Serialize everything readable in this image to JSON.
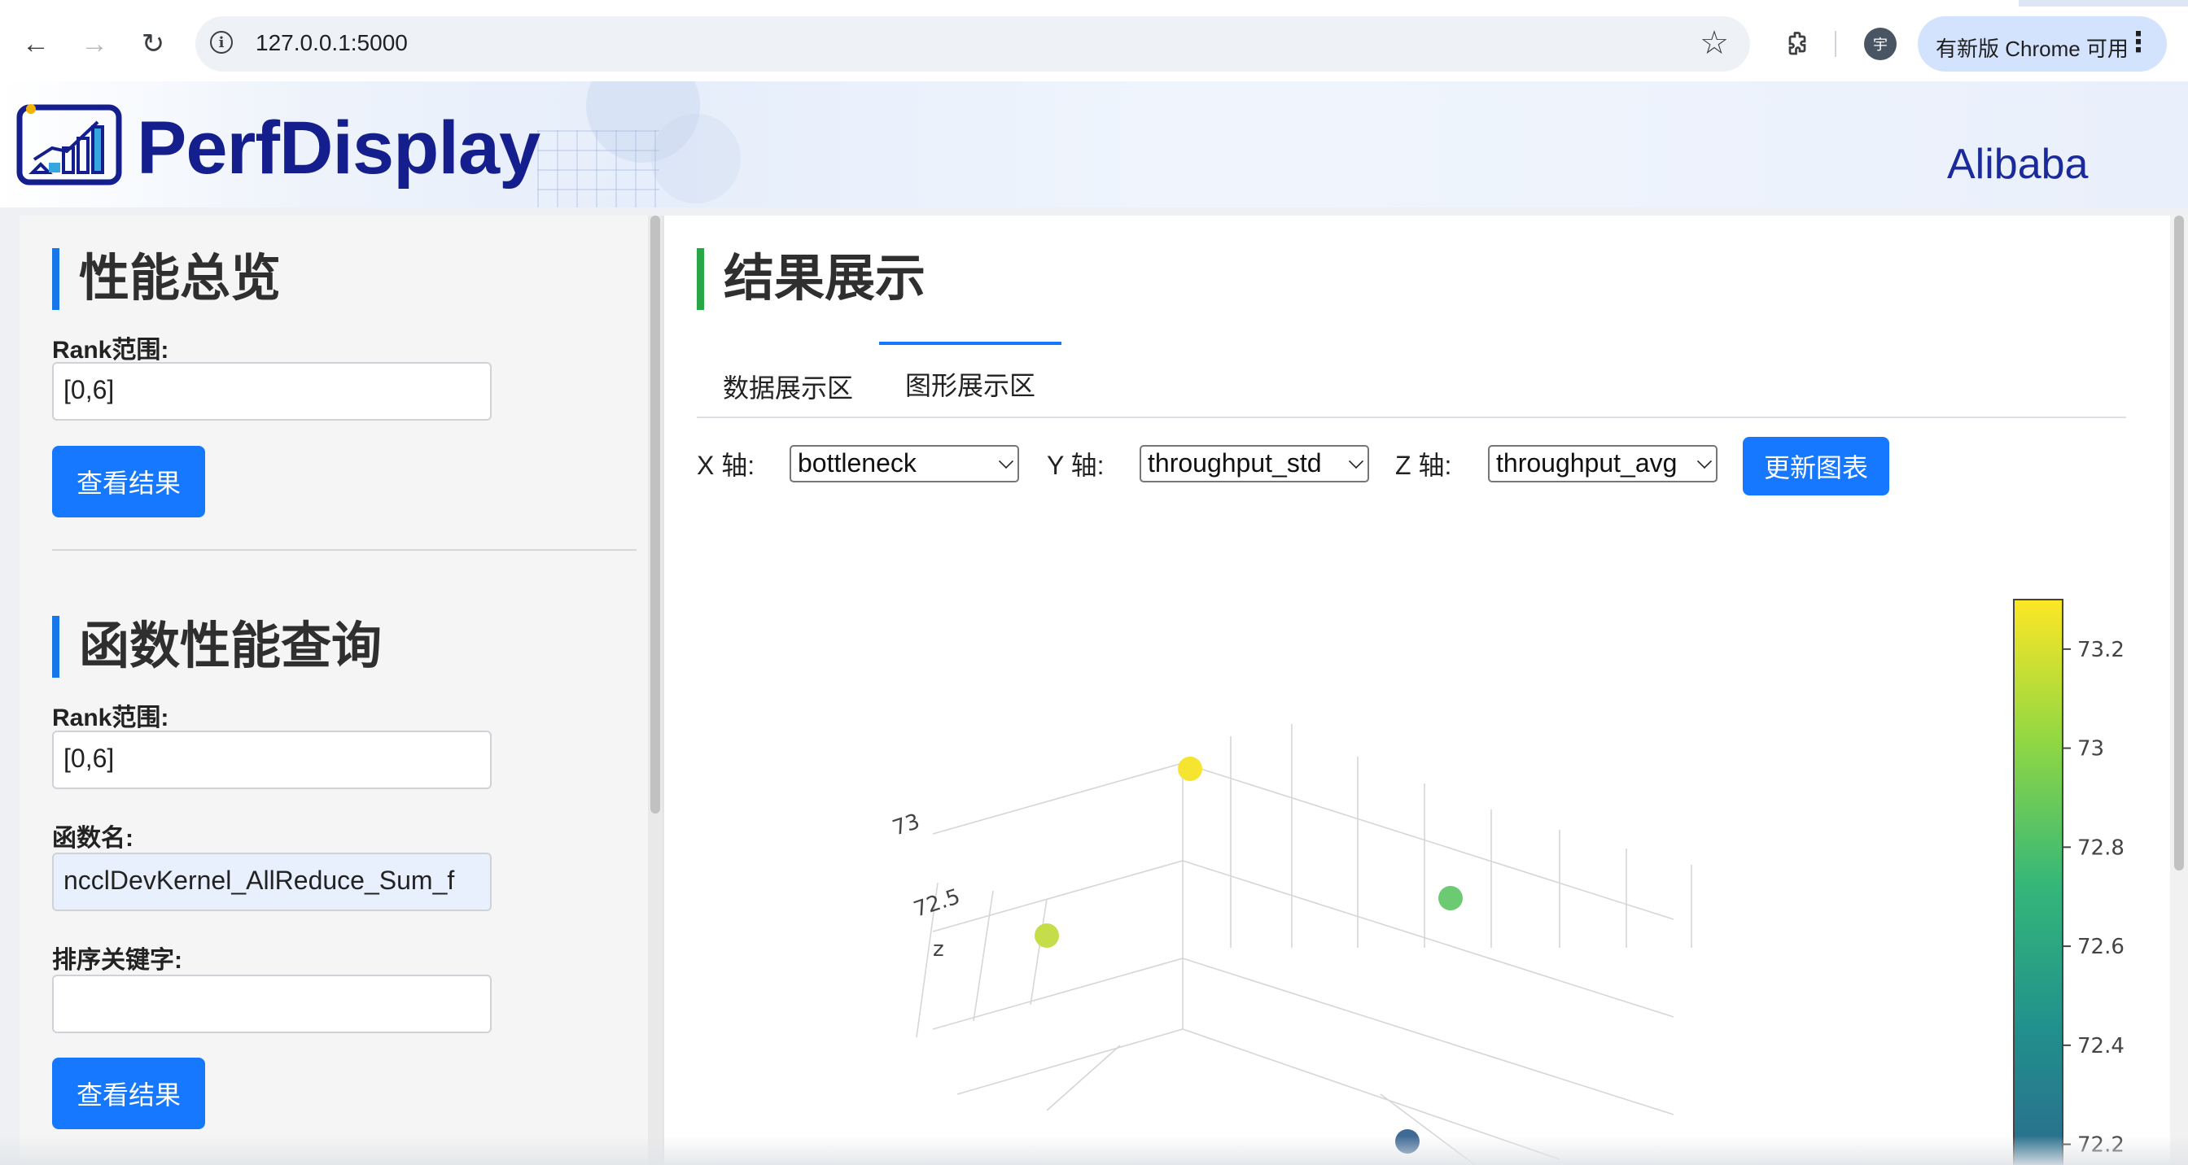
{
  "browser": {
    "url": "127.0.0.1:5000",
    "profile_initial": "宇",
    "update_label": "有新版 Chrome 可用"
  },
  "header": {
    "brand": "PerfDisplay",
    "company": "Alibaba"
  },
  "overview": {
    "title": "性能总览",
    "rank_label": "Rank范围:",
    "rank_value": "[0,6]",
    "submit_label": "查看结果"
  },
  "function_query": {
    "title": "函数性能查询",
    "rank_label": "Rank范围:",
    "rank_value": "[0,6]",
    "func_label": "函数名:",
    "func_value": "ncclDevKernel_AllReduce_Sum_f",
    "sort_label": "排序关键字:",
    "sort_value": "",
    "submit_label": "查看结果"
  },
  "results": {
    "title": "结果展示",
    "tabs": [
      {
        "label": "数据展示区",
        "active": false
      },
      {
        "label": "图形展示区",
        "active": true
      }
    ],
    "x_axis_label": "X 轴:",
    "x_axis_value": "bottleneck",
    "y_axis_label": "Y 轴:",
    "y_axis_value": "throughput_std",
    "z_axis_label": "Z 轴:",
    "z_axis_value": "throughput_avg",
    "update_label": "更新图表"
  },
  "chart_data": {
    "type": "scatter",
    "subtype": "3d",
    "zlabel": "z",
    "z_ticks": [
      "73",
      "72.5"
    ],
    "colorscale": "viridis",
    "colorbar": {
      "ticks": [
        "73.2",
        "73",
        "72.8",
        "72.6",
        "72.4",
        "72.2"
      ],
      "range": [
        72.15,
        73.3
      ]
    },
    "points": [
      {
        "z": 73.25,
        "color": "#f6e530"
      },
      {
        "z": 73.05,
        "color": "#c6dd4a"
      },
      {
        "z": 72.85,
        "color": "#6ccb72"
      },
      {
        "z": 72.2,
        "color": "#3f6a96"
      }
    ],
    "colors": {
      "accent": "#1677ff",
      "green_accent": "#27a745",
      "brand": "#141e8c"
    }
  }
}
